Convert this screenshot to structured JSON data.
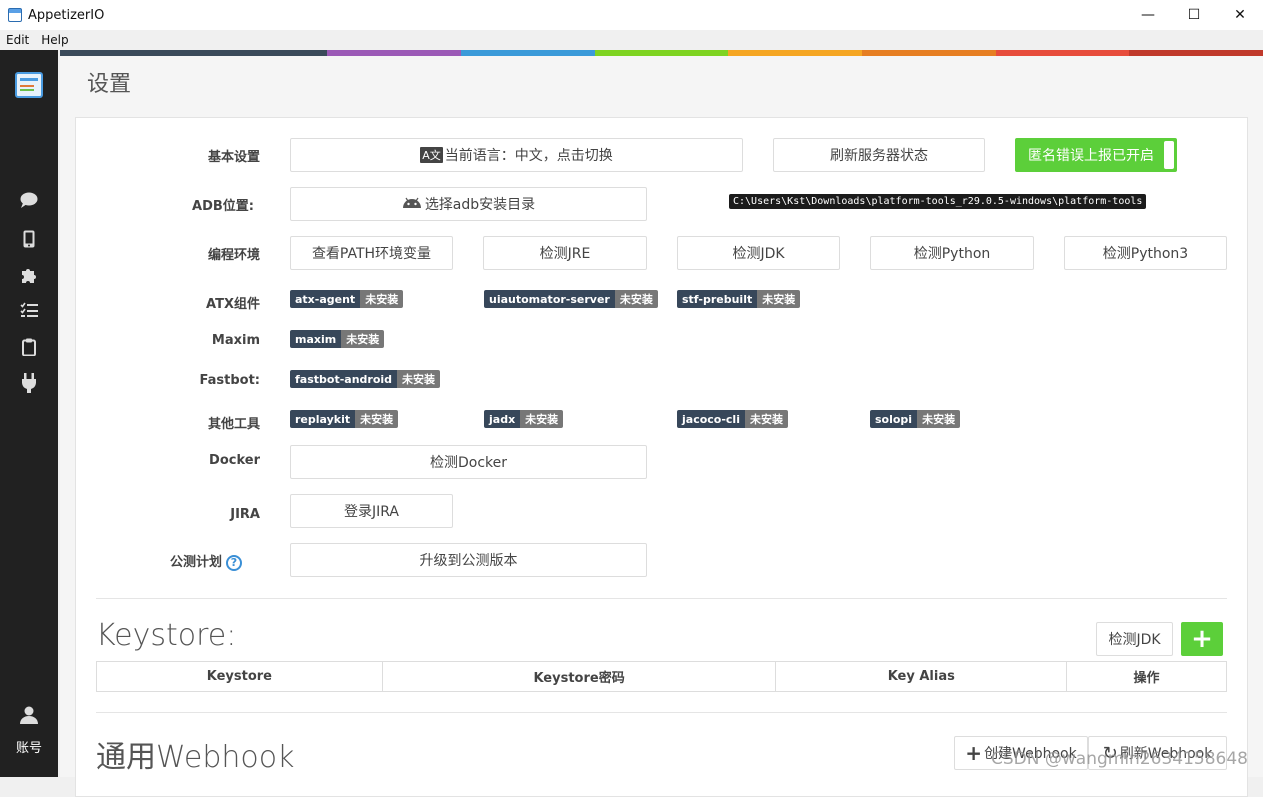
{
  "window": {
    "title": "AppetizerIO",
    "minimize_icon": "minimize-icon",
    "maximize_icon": "maximize-icon",
    "close_icon": "close-icon"
  },
  "menu": {
    "items": [
      "Edit",
      "Help"
    ]
  },
  "colorbar": [
    "#3a4a5a",
    "#3a4a5a",
    "#9b59b6",
    "#3a9ad9",
    "#7ed321",
    "#f5a623",
    "#e67e22",
    "#e74c3c",
    "#c0392b"
  ],
  "sidebar": {
    "icons": [
      "app-logo-icon",
      "chat-icon",
      "phone-icon",
      "puzzle-icon",
      "list-icon",
      "clipboard-icon",
      "plug-icon",
      "user-icon"
    ],
    "account_label": "账号"
  },
  "page": {
    "title": "设置"
  },
  "settings": {
    "basic": {
      "label": "基本设置",
      "language_button": "当前语言：中文，点击切换",
      "refresh_server": "刷新服务器状态",
      "error_report": "匿名错误上报已开启"
    },
    "adb": {
      "label": "ADB位置:",
      "button": "选择adb安装目录",
      "path": "C:\\Users\\Kst\\Downloads\\platform-tools_r29.0.5-windows\\platform-tools"
    },
    "env": {
      "label": "编程环境",
      "buttons": [
        "查看PATH环境变量",
        "检测JRE",
        "检测JDK",
        "检测Python",
        "检测Python3"
      ]
    },
    "atx": {
      "label": "ATX组件",
      "tags": [
        {
          "name": "atx-agent",
          "status": "未安装"
        },
        {
          "name": "uiautomator-server",
          "status": "未安装"
        },
        {
          "name": "stf-prebuilt",
          "status": "未安装"
        }
      ]
    },
    "maxim": {
      "label": "Maxim",
      "tags": [
        {
          "name": "maxim",
          "status": "未安装"
        }
      ]
    },
    "fastbot": {
      "label": "Fastbot:",
      "tags": [
        {
          "name": "fastbot-android",
          "status": "未安装"
        }
      ]
    },
    "tools": {
      "label": "其他工具",
      "tags": [
        {
          "name": "replaykit",
          "status": "未安装"
        },
        {
          "name": "jadx",
          "status": "未安装"
        },
        {
          "name": "jacoco-cli",
          "status": "未安装"
        },
        {
          "name": "solopi",
          "status": "未安装"
        }
      ]
    },
    "docker": {
      "label": "Docker",
      "button": "检测Docker"
    },
    "jira": {
      "label": "JIRA",
      "button": "登录JIRA"
    },
    "beta": {
      "label": "公测计划",
      "button": "升级到公测版本"
    }
  },
  "keystore": {
    "title": "Keystore:",
    "check_jdk": "检测JDK",
    "columns": [
      "Keystore",
      "Keystore密码",
      "Key Alias",
      "操作"
    ]
  },
  "webhook": {
    "title": "通用Webhook",
    "create": "创建Webhook",
    "refresh": "刷新Webhook"
  },
  "watermark": "CSDN @wangmin2634158648"
}
